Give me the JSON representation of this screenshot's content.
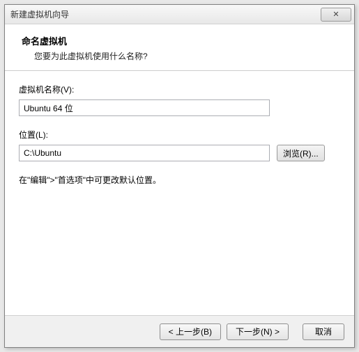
{
  "window": {
    "title": "新建虚拟机向导",
    "close_glyph": "✕"
  },
  "header": {
    "title": "命名虚拟机",
    "subtitle": "您要为此虚拟机使用什么名称?"
  },
  "fields": {
    "name_label": "虚拟机名称(V):",
    "name_value": "Ubuntu 64 位",
    "location_label": "位置(L):",
    "location_value": "C:\\Ubuntu",
    "browse_label": "浏览(R)..."
  },
  "hint": "在\"编辑\">\"首选项\"中可更改默认位置。",
  "footer": {
    "back_label": "< 上一步(B)",
    "next_label": "下一步(N) >",
    "cancel_label": "取消"
  }
}
